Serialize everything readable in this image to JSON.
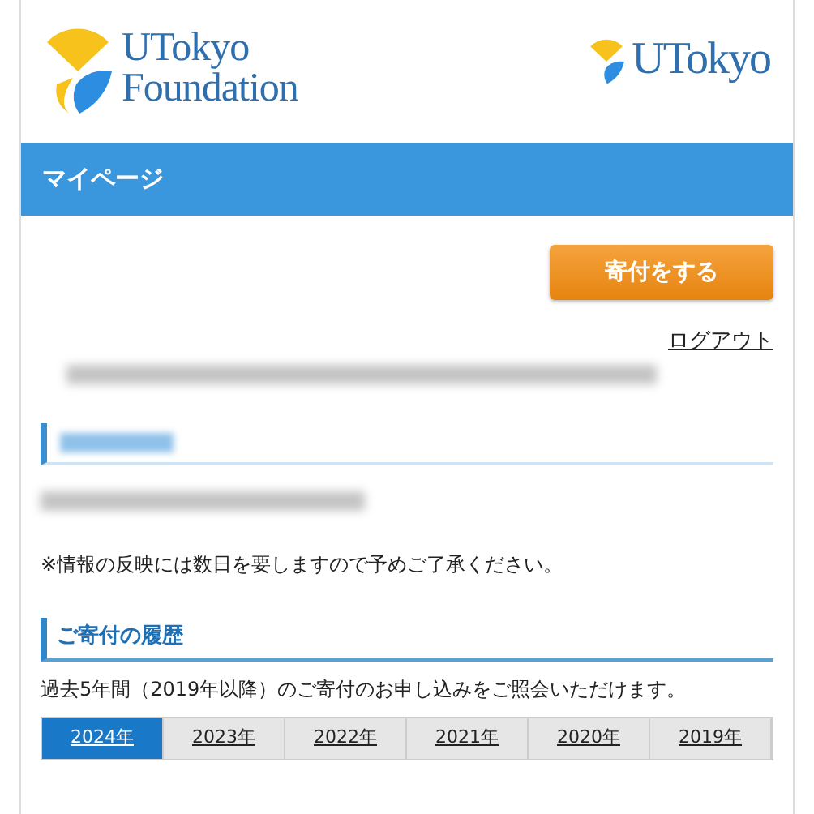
{
  "header": {
    "logo_lines": [
      "UTokyo",
      "Foundation"
    ],
    "logo_right": "UTokyo"
  },
  "title_bar": {
    "title": "マイページ"
  },
  "donate_button": {
    "label": "寄付をする"
  },
  "logout_link": {
    "label": "ログアウト"
  },
  "notice": "※情報の反映には数日を要しますので予めご了承ください。",
  "history": {
    "heading": "ご寄付の履歴",
    "description": "過去5年間（2019年以降）のご寄付のお申し込みをご照会いただけます。",
    "year_tabs": [
      {
        "label": "2024年",
        "selected": true
      },
      {
        "label": "2023年",
        "selected": false
      },
      {
        "label": "2022年",
        "selected": false
      },
      {
        "label": "2021年",
        "selected": false
      },
      {
        "label": "2020年",
        "selected": false
      },
      {
        "label": "2019年",
        "selected": false
      }
    ]
  }
}
